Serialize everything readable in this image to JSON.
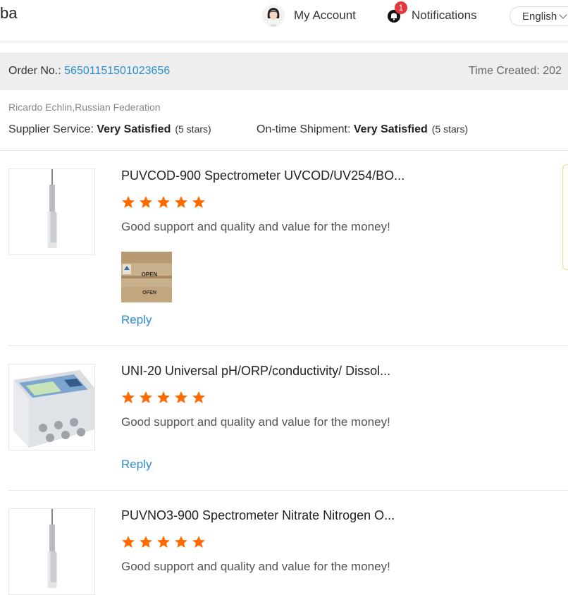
{
  "header": {
    "logo_text": "ba",
    "account_label": "My Account",
    "notifications_label": "Notifications",
    "notifications_count": "1",
    "language_label": "English"
  },
  "order": {
    "label": "Order No.: ",
    "number": "56501151501023656",
    "time_created_label": "Time Created: 202"
  },
  "buyer": {
    "name_country": "Ricardo Echlin,Russian Federation"
  },
  "ratings": {
    "supplier_service_label": "Supplier Service: ",
    "supplier_service_value": "Very Satisfied",
    "supplier_service_stars": "(5 stars)",
    "shipment_label": "On-time Shipment: ",
    "shipment_value": "Very Satisfied",
    "shipment_stars": "(5 stars)"
  },
  "reviews": [
    {
      "product_title": "PUVCOD-900 Spectrometer UVCOD/UV254/BO...",
      "rating": 5,
      "comment": "Good support and quality and value for the money!",
      "photo_text": [
        "OPEN",
        "OPEN"
      ],
      "reply_label": "Reply"
    },
    {
      "product_title": "UNI-20 Universal pH/ORP/conductivity/ Dissol...",
      "rating": 5,
      "comment": "Good support and quality and value for the money!",
      "reply_label": "Reply"
    },
    {
      "product_title": "PUVNO3-900 Spectrometer Nitrate Nitrogen O...",
      "rating": 5,
      "comment": "Good support and quality and value for the money!"
    }
  ],
  "colors": {
    "link_blue": "#2a8fd2",
    "star_orange": "#ff6a00",
    "badge_red": "#e4393c"
  },
  "icons": [
    "avatar",
    "bell-icon",
    "chevron-down-icon",
    "star-icon"
  ]
}
